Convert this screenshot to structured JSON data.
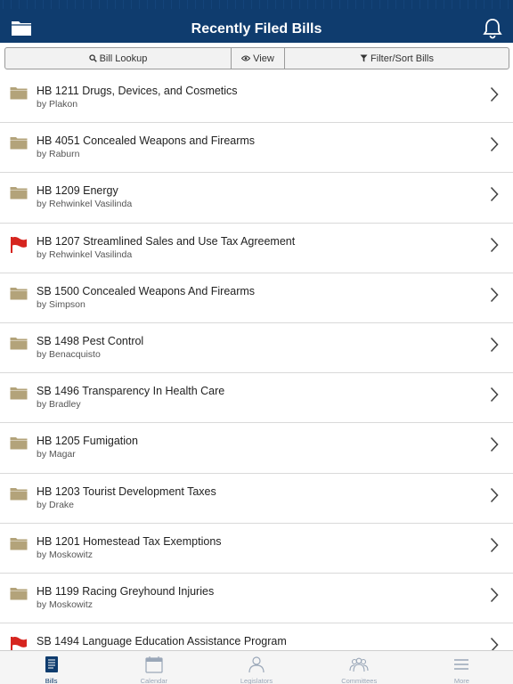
{
  "header": {
    "title": "Recently Filed Bills",
    "folder_icon": "folder-icon",
    "bell_icon": "bell-icon",
    "bg_color": "#0f3c6e"
  },
  "toolbar": {
    "lookup_label": "Bill Lookup",
    "view_label": "View",
    "filter_label": "Filter/Sort Bills"
  },
  "bills": [
    {
      "title": "HB 1211 Drugs, Devices, and Cosmetics",
      "sponsor": "by Plakon",
      "icon": "folder"
    },
    {
      "title": "HB 4051 Concealed Weapons and Firearms",
      "sponsor": "by Raburn",
      "icon": "folder"
    },
    {
      "title": "HB 1209 Energy",
      "sponsor": "by Rehwinkel Vasilinda",
      "icon": "folder"
    },
    {
      "title": "HB 1207 Streamlined Sales and Use Tax Agreement",
      "sponsor": "by Rehwinkel Vasilinda",
      "icon": "flag"
    },
    {
      "title": "SB 1500 Concealed Weapons And Firearms",
      "sponsor": "by Simpson",
      "icon": "folder"
    },
    {
      "title": "SB 1498 Pest Control",
      "sponsor": "by Benacquisto",
      "icon": "folder"
    },
    {
      "title": "SB 1496 Transparency In Health Care",
      "sponsor": "by Bradley",
      "icon": "folder"
    },
    {
      "title": "HB 1205 Fumigation",
      "sponsor": "by Magar",
      "icon": "folder"
    },
    {
      "title": "HB 1203 Tourist Development Taxes",
      "sponsor": "by Drake",
      "icon": "folder"
    },
    {
      "title": "HB 1201 Homestead Tax Exemptions",
      "sponsor": "by Moskowitz",
      "icon": "folder"
    },
    {
      "title": "HB 1199 Racing Greyhound Injuries",
      "sponsor": "by Moskowitz",
      "icon": "folder"
    },
    {
      "title": "SB 1494 Language Education Assistance Program",
      "sponsor": "",
      "icon": "flag"
    }
  ],
  "tabs": [
    {
      "label": "Bills",
      "icon": "bills-icon",
      "active": true
    },
    {
      "label": "Calendar",
      "icon": "calendar-icon",
      "active": false
    },
    {
      "label": "Legislators",
      "icon": "legislator-icon",
      "active": false
    },
    {
      "label": "Committees",
      "icon": "committees-icon",
      "active": false
    },
    {
      "label": "More",
      "icon": "menu-icon",
      "active": false
    }
  ],
  "colors": {
    "folder": "#b3a37a",
    "flag": "#d6251f",
    "tab_active": "#0f3c6e",
    "tab_inactive": "#9aa7b8"
  }
}
